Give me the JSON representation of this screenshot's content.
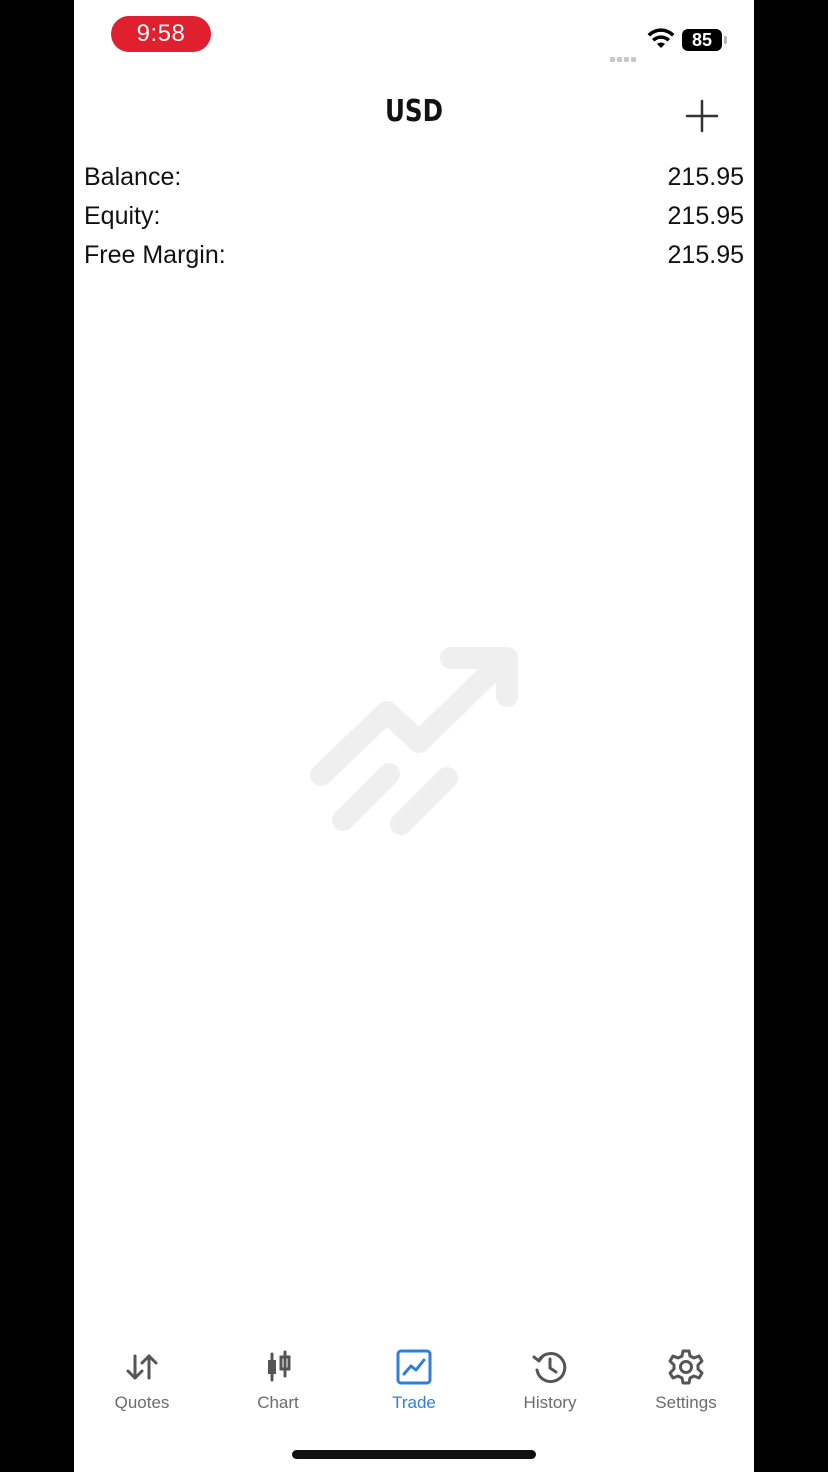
{
  "status_bar": {
    "time": "9:58",
    "battery_level": "85",
    "icons": [
      "signal-icon",
      "wifi-icon",
      "battery-icon"
    ]
  },
  "header": {
    "title": "USD",
    "add_icon": "plus-icon"
  },
  "account": {
    "rows": [
      {
        "label": "Balance:",
        "value": "215.95"
      },
      {
        "label": "Equity:",
        "value": "215.95"
      },
      {
        "label": "Free Margin:",
        "value": "215.95"
      }
    ]
  },
  "empty_state": {
    "icon": "trending-up-icon"
  },
  "tabs": [
    {
      "label": "Quotes",
      "icon": "quotes-arrows-icon",
      "active": false
    },
    {
      "label": "Chart",
      "icon": "candlestick-icon",
      "active": false
    },
    {
      "label": "Trade",
      "icon": "trade-chart-icon",
      "active": true
    },
    {
      "label": "History",
      "icon": "history-clock-icon",
      "active": false
    },
    {
      "label": "Settings",
      "icon": "gear-icon",
      "active": false
    }
  ],
  "colors": {
    "accent": "#2f7fd6",
    "time_pill": "#e0202e",
    "inactive_tab": "#6b6b6b",
    "empty_icon": "#efefef"
  }
}
